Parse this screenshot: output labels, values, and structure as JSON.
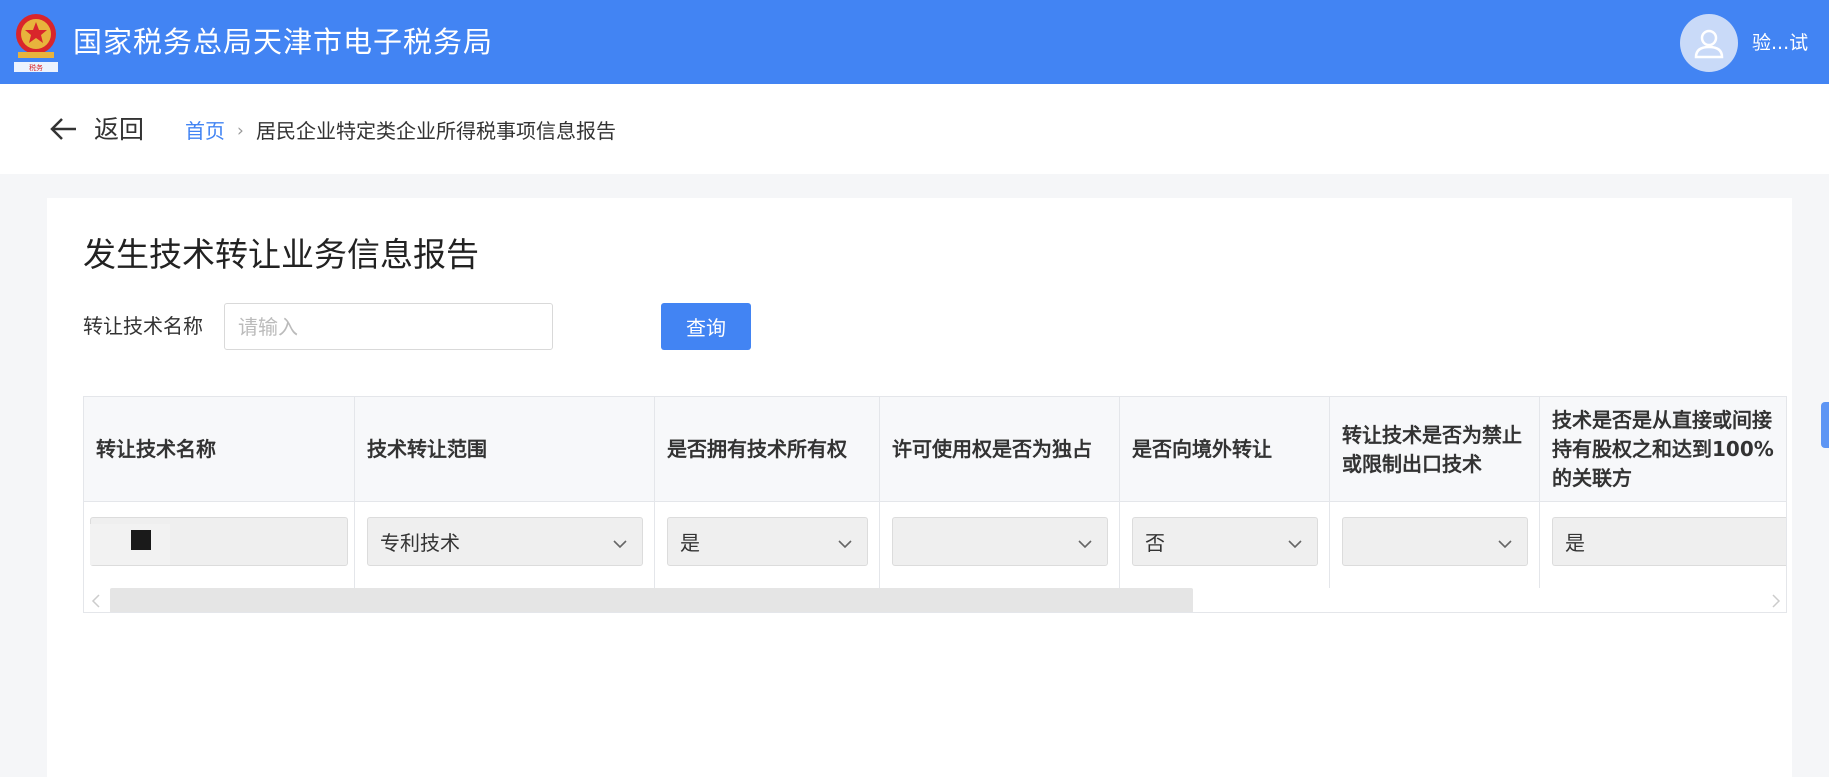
{
  "header": {
    "site_title": "国家税务总局天津市电子税务局",
    "username": "验...试",
    "brand_color": "#4284f3"
  },
  "nav": {
    "back_label": "返回",
    "breadcrumb_home": "首页",
    "breadcrumb_separator": "›",
    "breadcrumb_current": "居民企业特定类企业所得税事项信息报告"
  },
  "page": {
    "title": "发生技术转让业务信息报告"
  },
  "filter": {
    "label": "转让技术名称",
    "placeholder": "请输入",
    "value": "",
    "query_button": "查询"
  },
  "table": {
    "columns": [
      "转让技术名称",
      "技术转让范围",
      "是否拥有技术所有权",
      "许可使用权是否为独占",
      "是否向境外转让",
      "转让技术是否为禁止或限制出口技术",
      "技术是否是从直接或间接持有股权之和达到100%的关联方"
    ],
    "rows": [
      {
        "name": "",
        "scope": "专利技术",
        "own_tech": "是",
        "exclusive_license": "",
        "overseas": "否",
        "restricted_export": "",
        "related_party": "是"
      }
    ]
  },
  "icons": {
    "emblem": "national-emblem-icon",
    "avatar": "user-avatar-icon",
    "back": "arrow-left-icon",
    "dropdown": "chevron-down-icon"
  }
}
